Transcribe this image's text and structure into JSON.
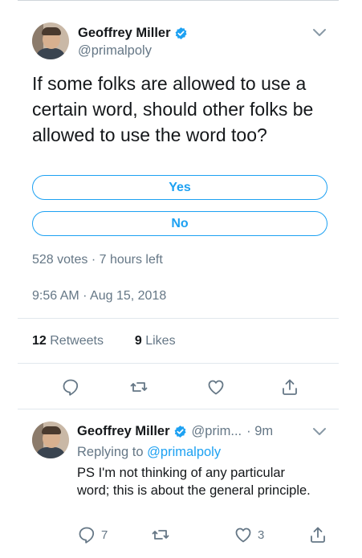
{
  "tweet": {
    "author_name": "Geoffrey Miller",
    "author_handle": "@primalpoly",
    "text": "If some folks are allowed to use a certain word, should other folks be allowed to use the word too?",
    "poll_options": [
      "Yes",
      "No"
    ],
    "poll_meta": "528 votes · 7 hours left",
    "timestamp": "9:56 AM · Aug 15, 2018",
    "retweets_count": "12",
    "retweets_label": "Retweets",
    "likes_count": "9",
    "likes_label": "Likes"
  },
  "reply": {
    "author_name": "Geoffrey Miller",
    "author_handle": "@prim...",
    "time": "· 9m",
    "replying_prefix": "Replying to",
    "replying_handle": "@primalpoly",
    "text": "PS I'm not thinking of any particular word; this is about the general principle.",
    "reply_count": "7",
    "like_count": "3"
  },
  "icons": {
    "verified": "verified-badge-icon",
    "chevron": "chevron-down-icon",
    "reply": "reply-icon",
    "retweet": "retweet-icon",
    "like": "heart-icon",
    "share": "share-icon"
  },
  "colors": {
    "accent": "#1da1f2",
    "text_primary": "#14171a",
    "text_secondary": "#657786",
    "divider": "#e1e8ed"
  }
}
